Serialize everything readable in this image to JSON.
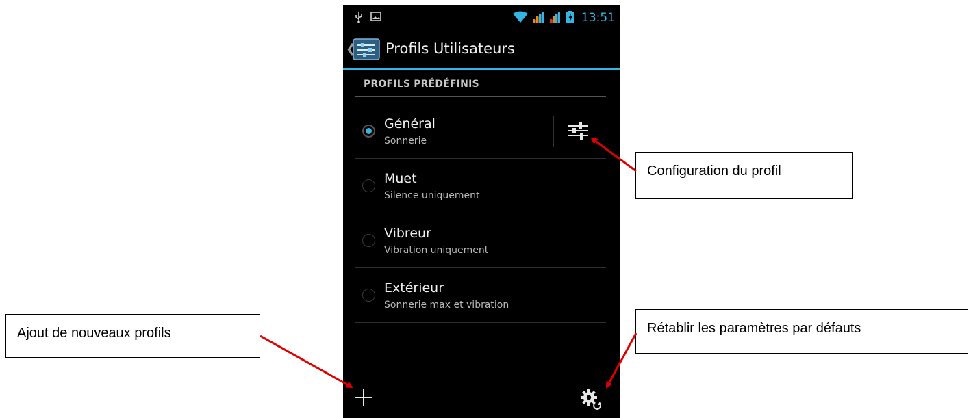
{
  "status_bar": {
    "time": "13:51",
    "icons": [
      "usb-icon",
      "image-notification-icon",
      "wifi-icon",
      "signal-icon",
      "signal-icon",
      "battery-charging-icon"
    ]
  },
  "action_bar": {
    "title": "Profils Utilisateurs",
    "up_icon": "back-chevron-icon",
    "app_icon": "settings-sliders-icon"
  },
  "section": {
    "header": "PROFILS PRÉDÉFINIS"
  },
  "profiles": [
    {
      "name": "Général",
      "description": "Sonnerie",
      "selected": true
    },
    {
      "name": "Muet",
      "description": "Silence uniquement",
      "selected": false
    },
    {
      "name": "Vibreur",
      "description": "Vibration uniquement",
      "selected": false
    },
    {
      "name": "Extérieur",
      "description": "Sonnerie max et vibration",
      "selected": false
    }
  ],
  "bottom_bar": {
    "add_icon": "plus-icon",
    "reset_icon": "gear-reset-icon"
  },
  "callouts": {
    "config": "Configuration du profil",
    "add": "Ajout de nouveaux profils",
    "reset": "Rétablir les paramètres par défauts"
  },
  "colors": {
    "accent": "#33b5e5",
    "arrow": "#e00000",
    "background": "#000000"
  }
}
